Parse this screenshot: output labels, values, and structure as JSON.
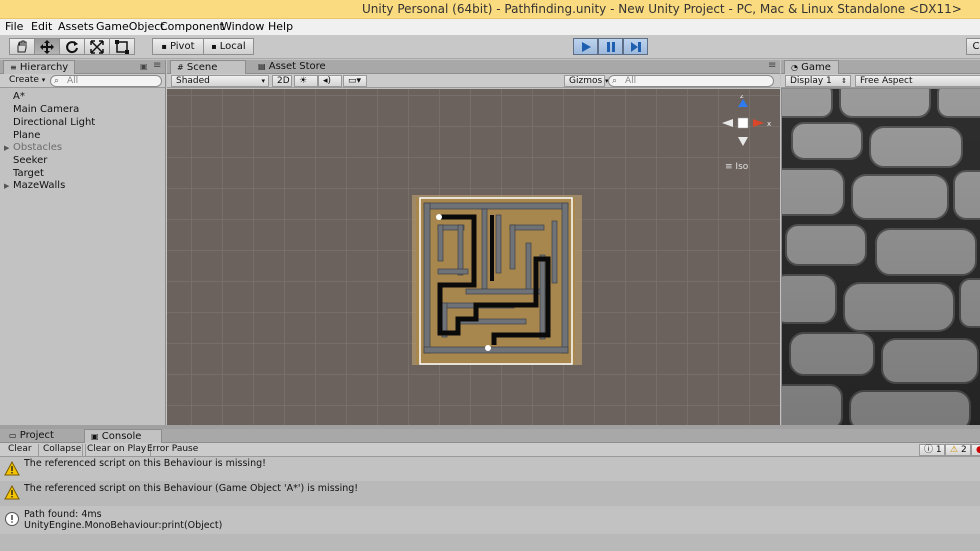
{
  "window": {
    "title": "Unity Personal (64bit) - Pathfinding.unity - New Unity Project - PC, Mac & Linux Standalone <DX11>"
  },
  "menu": [
    {
      "label": "File"
    },
    {
      "label": "Edit"
    },
    {
      "label": "Assets"
    },
    {
      "label": "GameObject"
    },
    {
      "label": "Component"
    },
    {
      "label": "Window"
    },
    {
      "label": "Help"
    }
  ],
  "toolbar": {
    "pivot_label": "Pivot",
    "local_label": "Local",
    "cloud_label": "C"
  },
  "hierarchy": {
    "tab_label": "Hierarchy",
    "create_label": "Create",
    "search_placeholder": "All",
    "items": [
      {
        "label": "A*"
      },
      {
        "label": "Main Camera"
      },
      {
        "label": "Directional Light"
      },
      {
        "label": "Plane"
      },
      {
        "label": "Obstacles"
      },
      {
        "label": "Seeker"
      },
      {
        "label": "Target"
      },
      {
        "label": "MazeWalls"
      }
    ]
  },
  "scene": {
    "tab_scene": "Scene",
    "tab_asset_store": "Asset Store",
    "shading": "Shaded",
    "mode_2d": "2D",
    "gizmos_label": "Gizmos",
    "search_placeholder": "All",
    "gizmo_y": "y",
    "gizmo_x": "x",
    "gizmo_z": "z",
    "iso_label": "Iso"
  },
  "game": {
    "tab_label": "Game",
    "display": "Display 1",
    "aspect": "Free Aspect"
  },
  "console": {
    "tab_project": "Project",
    "tab_console": "Console",
    "clear_label": "Clear",
    "collapse_label": "Collapse",
    "clear_on_play_label": "Clear on Play",
    "error_pause_label": "Error Pause",
    "info_count": "1",
    "warning_count": "2",
    "messages": [
      {
        "type": "warning",
        "line1": "The referenced script on this Behaviour is missing!",
        "line2": ""
      },
      {
        "type": "warning",
        "line1": "The referenced script on this Behaviour (Game Object 'A*') is missing!",
        "line2": ""
      },
      {
        "type": "info",
        "line1": "Path found: 4ms",
        "line2": "UnityEngine.MonoBehaviour:print(Object)"
      }
    ]
  },
  "colors": {
    "title_bar": "#fbdb7f",
    "play_active": "#9fb9db",
    "scene_bg": "#6b625d"
  }
}
